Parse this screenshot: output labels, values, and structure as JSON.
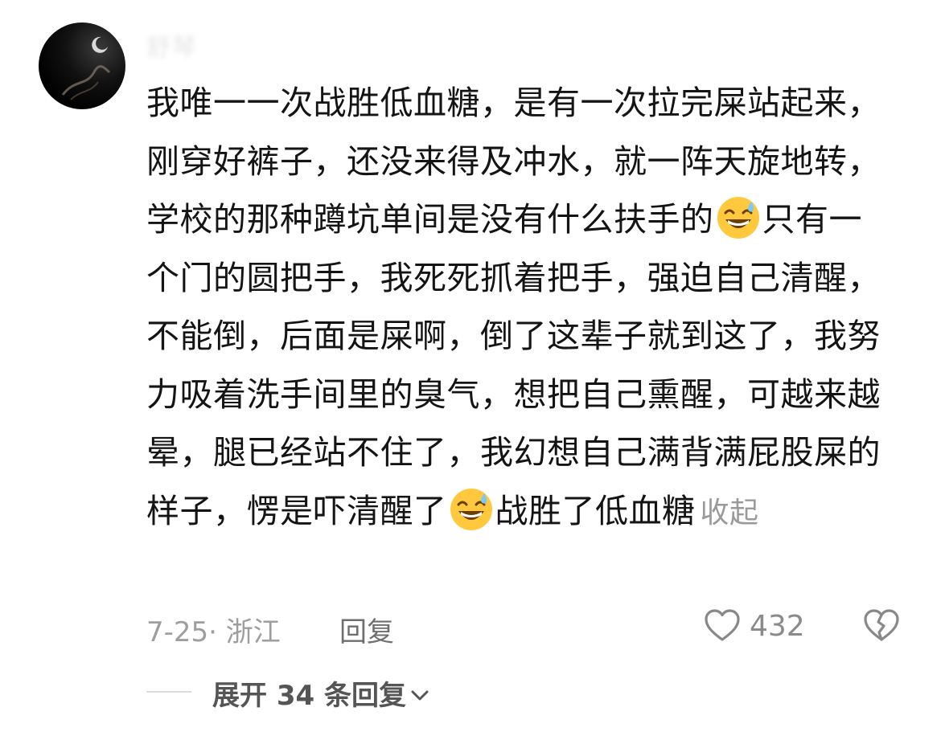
{
  "comment": {
    "username": "舒琴",
    "text_part1": "我唯一一次战胜低血糖，是有一次拉完屎站起来，刚穿好裤子，还没来得及冲水，就一阵天旋地转，学校的那种蹲坑单间是没有什么扶手的",
    "text_part2": "只有一个门的圆把手，我死死抓着把手，强迫自己清醒，不能倒，后面是屎啊，倒了这辈子就到这了，我努力吸着洗手间里的臭气，想把自己熏醒，可越来越晕，腿已经站不住了，我幻想自己满背满屁股屎的样子，愣是吓清醒了",
    "text_part3": "战胜了低血糖",
    "collapse_label": "收起",
    "emoji_icon": "grinning-sweat-emoji-icon"
  },
  "meta": {
    "date_location": "7-25· 浙江",
    "reply_label": "回复",
    "like_count": "432"
  },
  "replies": {
    "expand_label": "展开 34 条回复"
  },
  "colors": {
    "text": "#141414",
    "muted": "#9e9e9e",
    "emoji_face": "#FFC83D"
  }
}
